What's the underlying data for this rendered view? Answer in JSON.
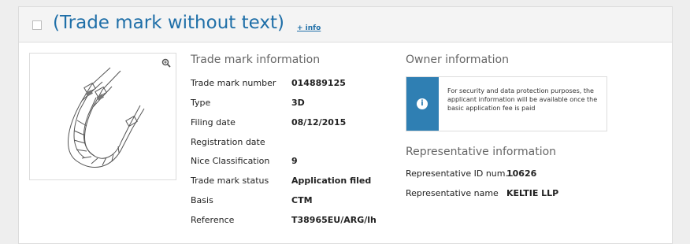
{
  "header": {
    "title": "(Trade mark without text)",
    "info_link": "+ info"
  },
  "image_panel": {
    "zoom_icon": "zoom-icon"
  },
  "trade_mark_info": {
    "title": "Trade mark information",
    "rows": [
      {
        "label": "Trade mark number",
        "value": "014889125"
      },
      {
        "label": "Type",
        "value": "3D"
      },
      {
        "label": "Filing date",
        "value": "08/12/2015"
      },
      {
        "label": "Registration date",
        "value": ""
      },
      {
        "label": "Nice Classification",
        "value": "9"
      },
      {
        "label": "Trade mark status",
        "value": "Application filed"
      },
      {
        "label": "Basis",
        "value": "CTM"
      },
      {
        "label": "Reference",
        "value": "T38965EU/ARG/lh"
      }
    ]
  },
  "owner_info": {
    "title": "Owner information",
    "notice": "For security and data protection purposes, the applicant information will be available once the basic application fee is paid",
    "notice_icon": "info-icon"
  },
  "representative_info": {
    "title": "Representative information",
    "rows": [
      {
        "label": "Representative ID num...",
        "value": "10626"
      },
      {
        "label": "Representative name",
        "value": "KELTIE LLP"
      }
    ]
  },
  "colors": {
    "accent": "#1f6fa8",
    "notice_bar": "#2f7fb3",
    "header_bg": "#f4f4f4"
  }
}
